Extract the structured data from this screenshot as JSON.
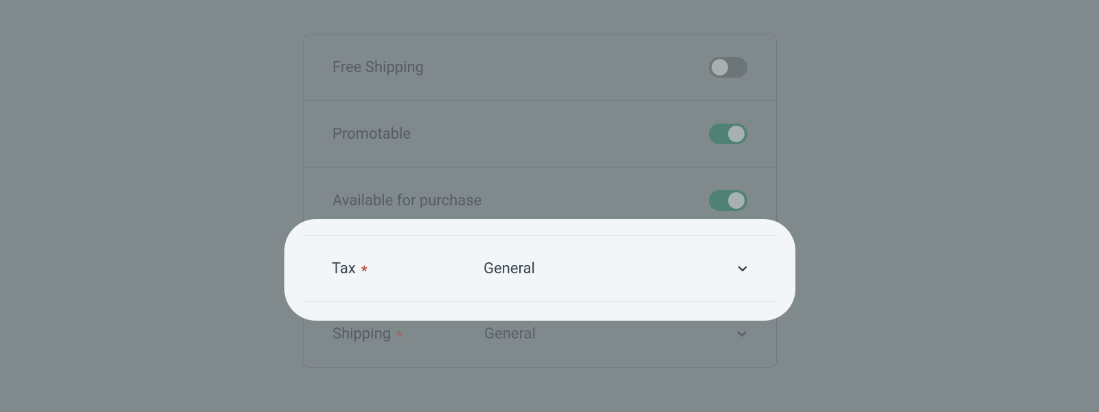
{
  "settings": {
    "free_shipping": {
      "label": "Free Shipping",
      "on": false
    },
    "promotable": {
      "label": "Promotable",
      "on": true
    },
    "available": {
      "label": "Available for purchase",
      "on": true
    },
    "tax": {
      "label": "Tax",
      "required": true,
      "value": "General"
    },
    "shipping": {
      "label": "Shipping",
      "required": true,
      "value": "General"
    }
  },
  "glyphs": {
    "required": "*"
  }
}
